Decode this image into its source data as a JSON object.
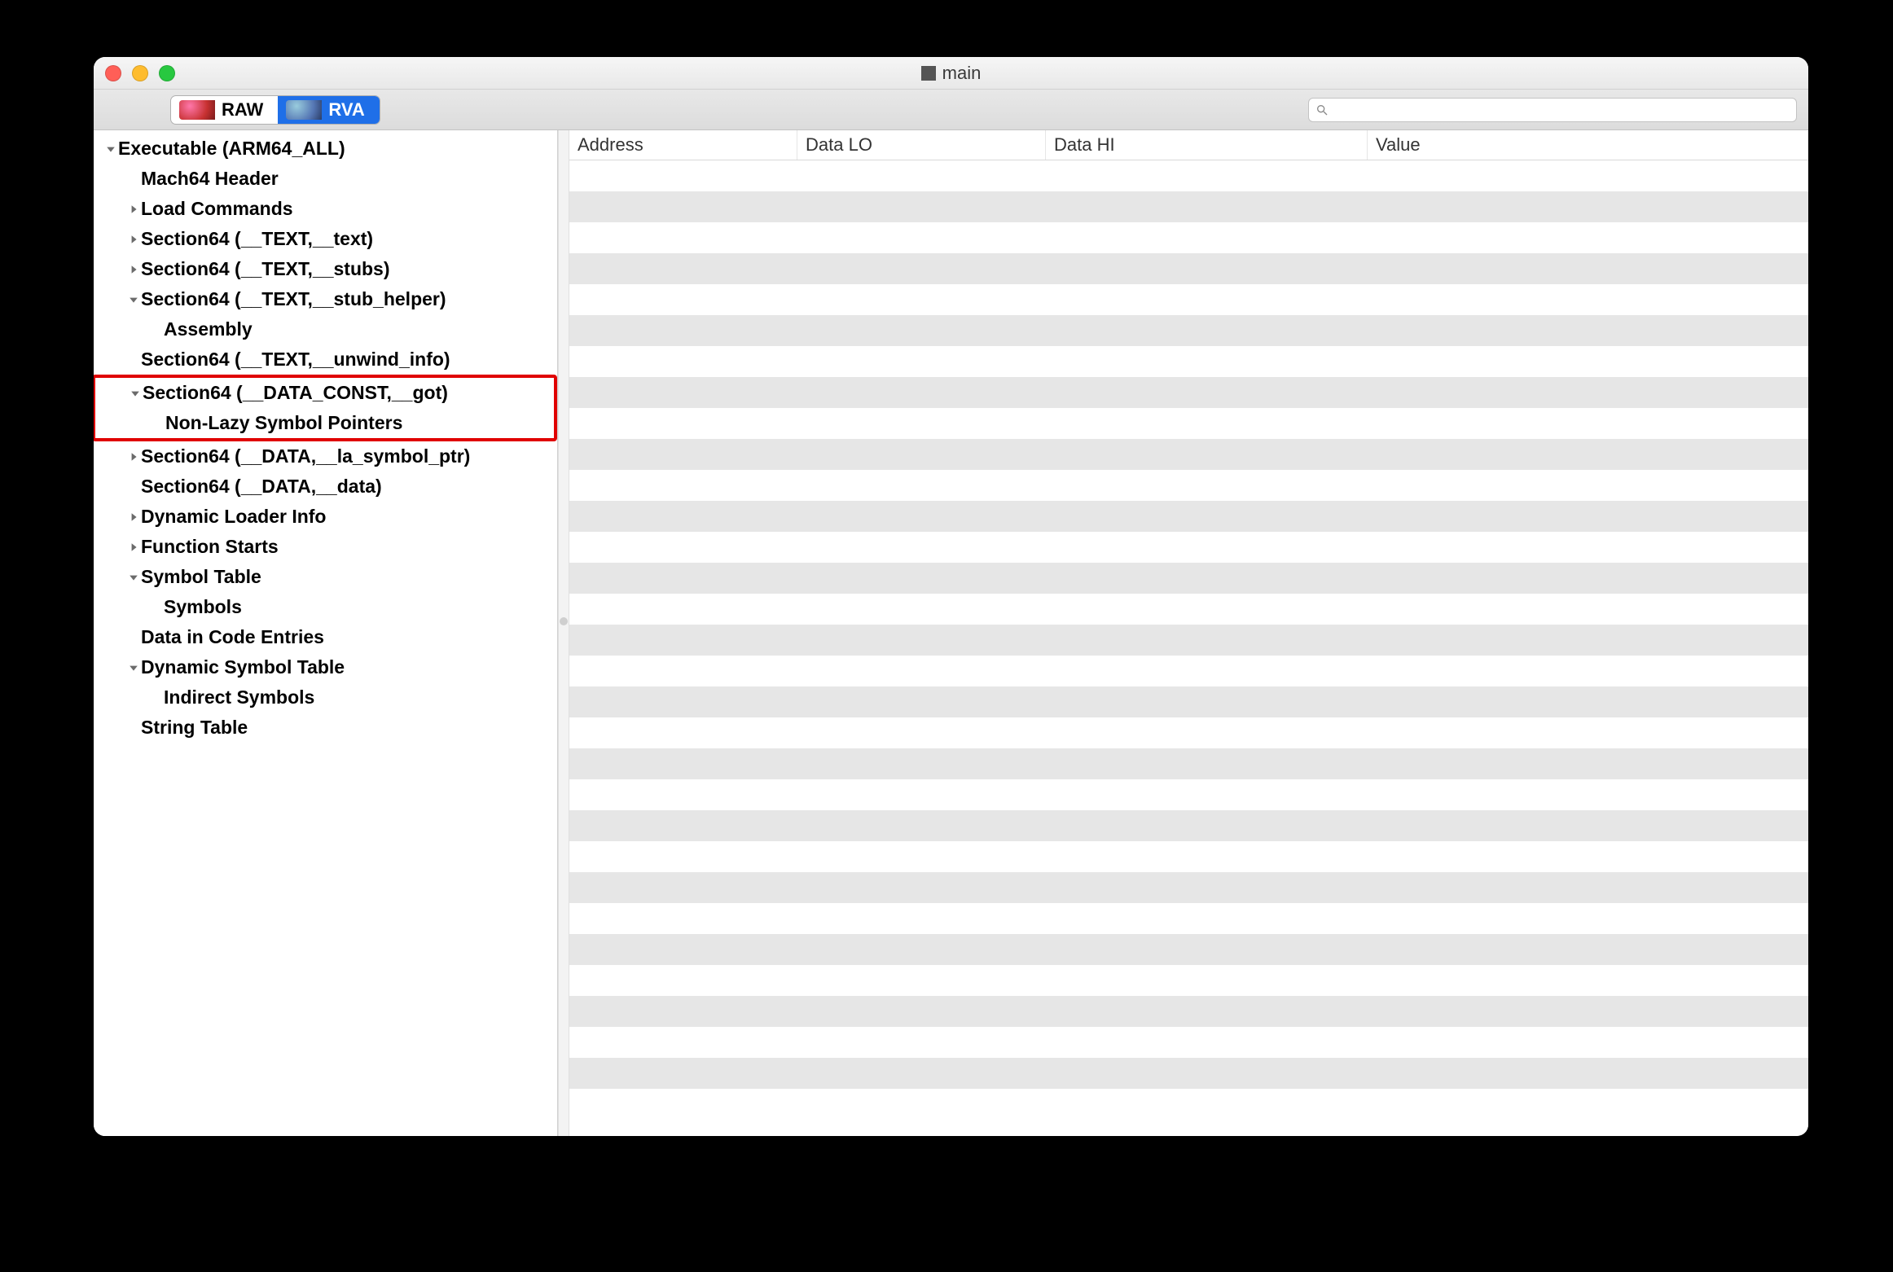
{
  "window": {
    "title": "main"
  },
  "toolbar": {
    "seg_raw": "RAW",
    "seg_rva": "RVA",
    "search_placeholder": ""
  },
  "table": {
    "headers": {
      "c0": "Address",
      "c1": "Data LO",
      "c2": "Data HI",
      "c3": "Value"
    },
    "row_count": 30
  },
  "tree": [
    {
      "indent": 0,
      "disclosure": "down",
      "bold": true,
      "label": "Executable  (ARM64_ALL)",
      "name": "tree-executable"
    },
    {
      "indent": 1,
      "disclosure": "",
      "bold": true,
      "label": "Mach64 Header",
      "name": "tree-mach64-header"
    },
    {
      "indent": 1,
      "disclosure": "right",
      "bold": true,
      "label": "Load Commands",
      "name": "tree-load-commands"
    },
    {
      "indent": 1,
      "disclosure": "right",
      "bold": true,
      "label": "Section64 (__TEXT,__text)",
      "name": "tree-section-text-text"
    },
    {
      "indent": 1,
      "disclosure": "right",
      "bold": true,
      "label": "Section64 (__TEXT,__stubs)",
      "name": "tree-section-text-stubs"
    },
    {
      "indent": 1,
      "disclosure": "down",
      "bold": true,
      "label": "Section64 (__TEXT,__stub_helper)",
      "name": "tree-section-text-stub-helper"
    },
    {
      "indent": 2,
      "disclosure": "",
      "bold": true,
      "label": "Assembly",
      "name": "tree-assembly"
    },
    {
      "indent": 1,
      "disclosure": "",
      "bold": true,
      "label": "Section64 (__TEXT,__unwind_info)",
      "name": "tree-section-text-unwind-info"
    },
    {
      "hl_start": true
    },
    {
      "indent": 1,
      "disclosure": "down",
      "bold": true,
      "label": "Section64 (__DATA_CONST,__got)",
      "name": "tree-section-data-const-got"
    },
    {
      "indent": 2,
      "disclosure": "",
      "bold": true,
      "label": "Non-Lazy Symbol Pointers",
      "name": "tree-non-lazy-symbol-pointers"
    },
    {
      "hl_end": true
    },
    {
      "indent": 1,
      "disclosure": "right",
      "bold": true,
      "label": "Section64 (__DATA,__la_symbol_ptr)",
      "name": "tree-section-data-la-symbol-ptr"
    },
    {
      "indent": 1,
      "disclosure": "",
      "bold": true,
      "label": "Section64 (__DATA,__data)",
      "name": "tree-section-data-data"
    },
    {
      "indent": 1,
      "disclosure": "right",
      "bold": true,
      "label": "Dynamic Loader Info",
      "name": "tree-dynamic-loader-info"
    },
    {
      "indent": 1,
      "disclosure": "right",
      "bold": true,
      "label": "Function Starts",
      "name": "tree-function-starts"
    },
    {
      "indent": 1,
      "disclosure": "down",
      "bold": true,
      "label": "Symbol Table",
      "name": "tree-symbol-table"
    },
    {
      "indent": 2,
      "disclosure": "",
      "bold": true,
      "label": "Symbols",
      "name": "tree-symbols"
    },
    {
      "indent": 1,
      "disclosure": "",
      "bold": true,
      "label": "Data in Code Entries",
      "name": "tree-data-in-code-entries"
    },
    {
      "indent": 1,
      "disclosure": "down",
      "bold": true,
      "label": "Dynamic Symbol Table",
      "name": "tree-dynamic-symbol-table"
    },
    {
      "indent": 2,
      "disclosure": "",
      "bold": true,
      "label": "Indirect Symbols",
      "name": "tree-indirect-symbols"
    },
    {
      "indent": 1,
      "disclosure": "",
      "bold": true,
      "label": "String Table",
      "name": "tree-string-table"
    }
  ]
}
